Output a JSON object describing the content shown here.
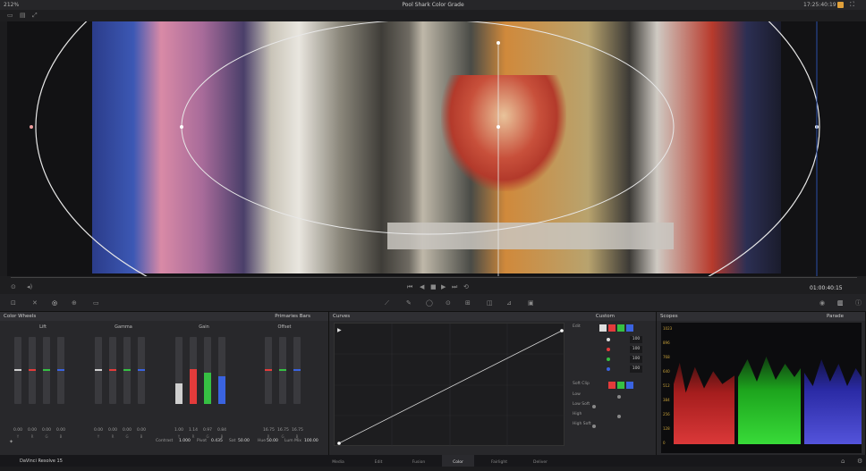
{
  "topbar": {
    "zoom": "212%",
    "title": "Pool Shark Color Grade",
    "timecode": "17:25:40:19"
  },
  "viewer": {
    "timecode": "01:00:40:15"
  },
  "color_wheels": {
    "title": "Color Wheels",
    "mode": "Primaries Bars",
    "wheels": [
      {
        "label": "Lift",
        "values": [
          "0.00",
          "0.00",
          "0.00",
          "0.00"
        ]
      },
      {
        "label": "Gamma",
        "values": [
          "0.00",
          "0.00",
          "0.00",
          "0.00"
        ]
      },
      {
        "label": "Gain",
        "values": [
          "1.00",
          "1.14",
          "0.97",
          "0.84"
        ]
      },
      {
        "label": "Offset",
        "values": [
          "16.75",
          "16.75",
          "16.75"
        ]
      }
    ],
    "channels": [
      "Y",
      "R",
      "G",
      "B"
    ],
    "bottom": {
      "contrast_label": "Contrast",
      "contrast": "1.000",
      "pivot_label": "Pivot",
      "pivot": "0.435",
      "sat_label": "Sat",
      "sat": "50.00",
      "hue_label": "Hue",
      "hue": "50.00",
      "lummix_label": "Lum Mix",
      "lummix": "100.00"
    }
  },
  "curves": {
    "title": "Curves",
    "mode": "Custom",
    "edit": {
      "label": "Edit",
      "values": [
        "100",
        "100",
        "100",
        "100"
      ]
    },
    "softclip": {
      "label": "Soft Clip",
      "rows": [
        "Low",
        "Low Soft",
        "High",
        "High Soft"
      ]
    }
  },
  "scopes": {
    "title": "Scopes",
    "mode": "Parade",
    "scale": [
      "1023",
      "896",
      "768",
      "640",
      "512",
      "384",
      "256",
      "128",
      "0"
    ]
  },
  "footer": {
    "app": "DaVinci Resolve 15",
    "pages": [
      "Media",
      "Edit",
      "Fusion",
      "Color",
      "Fairlight",
      "Deliver"
    ]
  },
  "colors": {
    "red": "#e33b3b",
    "green": "#36c043",
    "blue": "#3a63e0",
    "accent": "#e0a03a"
  }
}
